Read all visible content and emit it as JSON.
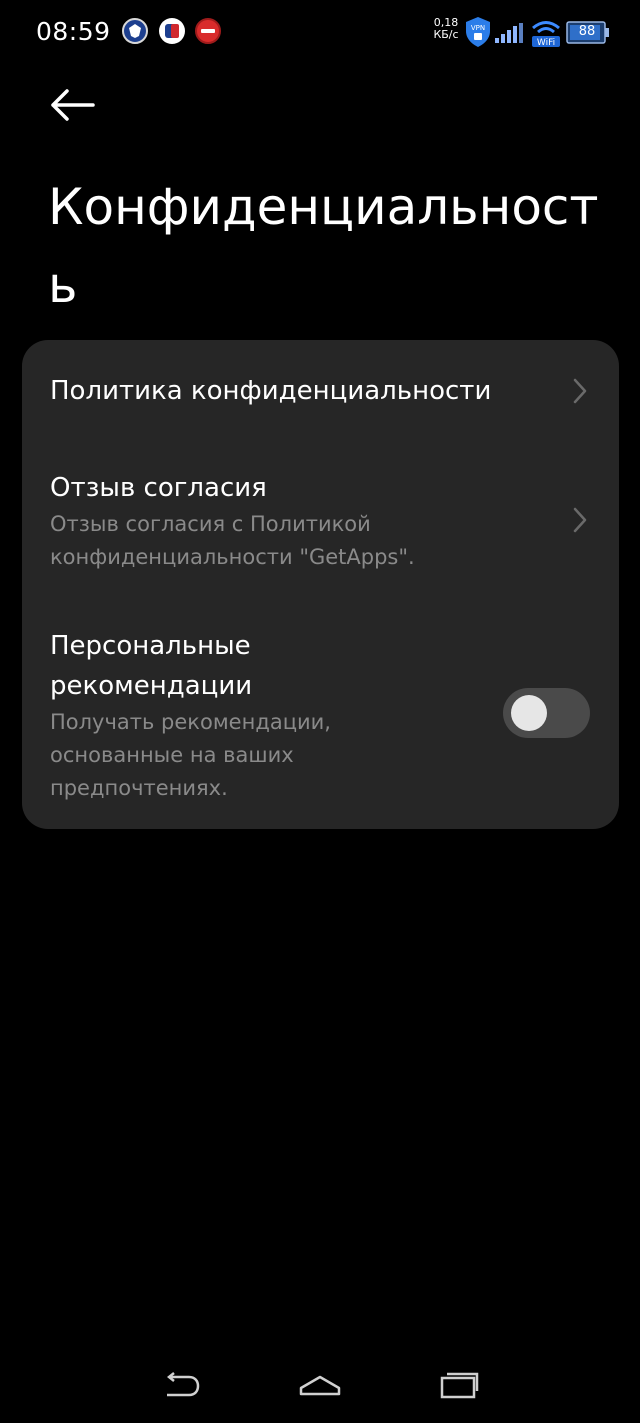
{
  "status_bar": {
    "time": "08:59",
    "net_speed_value": "0,18",
    "net_speed_unit": "КБ/с",
    "battery_level": "88",
    "icons": [
      "vpn-icon",
      "signal-icon",
      "wifi-icon",
      "battery-icon"
    ],
    "notification_icons": [
      "app-notification-icon-1",
      "app-notification-icon-2",
      "app-notification-icon-3"
    ]
  },
  "header": {
    "back_icon": "arrow-left-icon",
    "title": "Конфиденциальность"
  },
  "settings": [
    {
      "title": "Политика конфиденциальности",
      "subtitle": "",
      "control": "chevron-right-icon"
    },
    {
      "title": "Отзыв согласия",
      "subtitle": "Отзыв согласия с Политикой конфиденциальности \"GetApps\".",
      "control": "chevron-right-icon"
    },
    {
      "title": "Персональные рекомендации",
      "subtitle": "Получать рекомендации, основанные на ваших предпочтениях.",
      "control": "toggle",
      "enabled": false
    }
  ],
  "nav_bar": {
    "icons": [
      "back-nav-icon",
      "home-nav-icon",
      "recents-nav-icon"
    ]
  },
  "colors": {
    "background": "#000000",
    "card": "#262626",
    "primary_text": "#ffffff",
    "secondary_text": "#8a8a8a",
    "toggle_track_off": "#4a4a4a"
  }
}
